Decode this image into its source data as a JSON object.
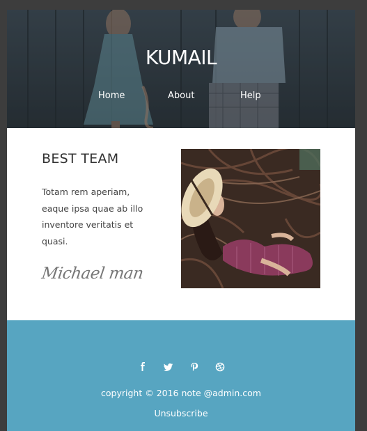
{
  "header": {
    "brand": "KUMAIL",
    "nav": [
      "Home",
      "About",
      "Help"
    ]
  },
  "content": {
    "heading": "BEST TEAM",
    "paragraph": "Totam rem aperiam, eaque ipsa quae ab illo inventore veritatis et quasi.",
    "signature": "Michael man"
  },
  "footer": {
    "social_icons": [
      "facebook-icon",
      "twitter-icon",
      "pinterest-icon",
      "dribbble-icon"
    ],
    "copyright": "copyright © 2016 note @admin.com",
    "unsubscribe": "Unsubscribe"
  },
  "colors": {
    "page_background": "#3d3d3d",
    "footer_background": "#57a5c1",
    "header_overlay": "#2b353c",
    "text_dark": "#333333"
  }
}
